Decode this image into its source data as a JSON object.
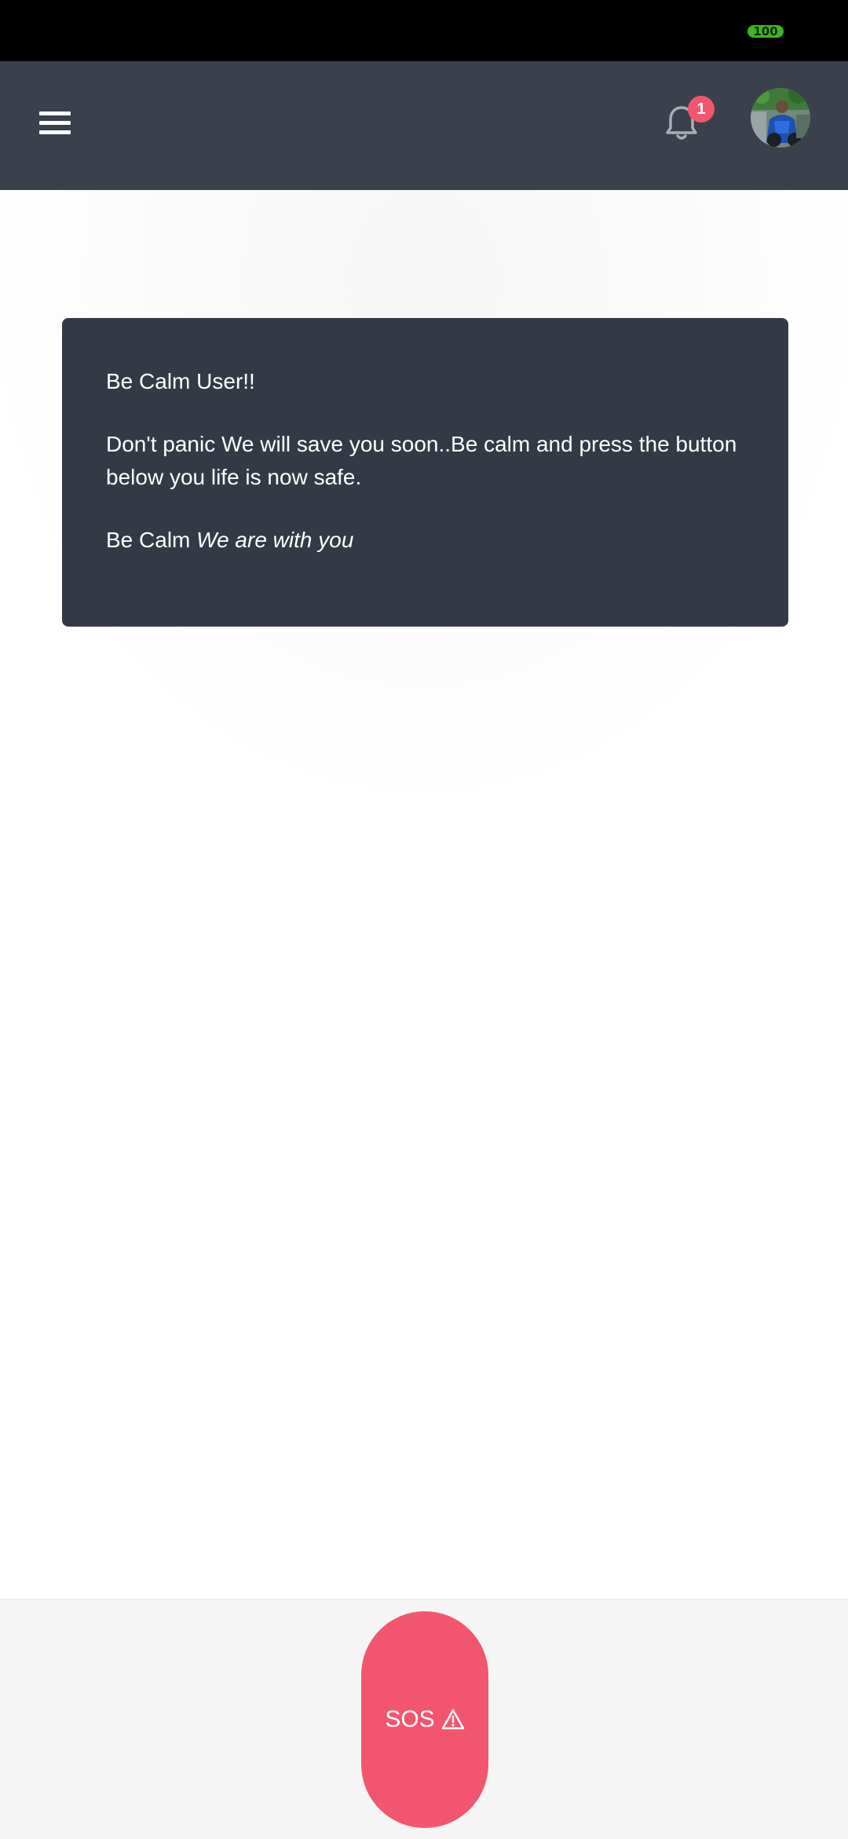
{
  "status_bar": {
    "battery": "100",
    "battery_color": "#3fb51f"
  },
  "app_bar": {
    "background": "#3b414c",
    "menu_icon": "hamburger-menu-icon",
    "notification_icon": "bell-icon",
    "notification_count": "1",
    "badge_color": "#f2566e",
    "avatar": "user-avatar"
  },
  "message_card": {
    "background": "#343a45",
    "greeting": "Be Calm User!!",
    "body": "Don't panic We will save you soon..Be calm and press the button below you life is now safe.",
    "closing_plain": "Be Calm",
    "closing_italic": "We are with you"
  },
  "sos_button": {
    "label": "SOS",
    "icon": "warning-triangle-icon",
    "color": "#f2566e"
  }
}
